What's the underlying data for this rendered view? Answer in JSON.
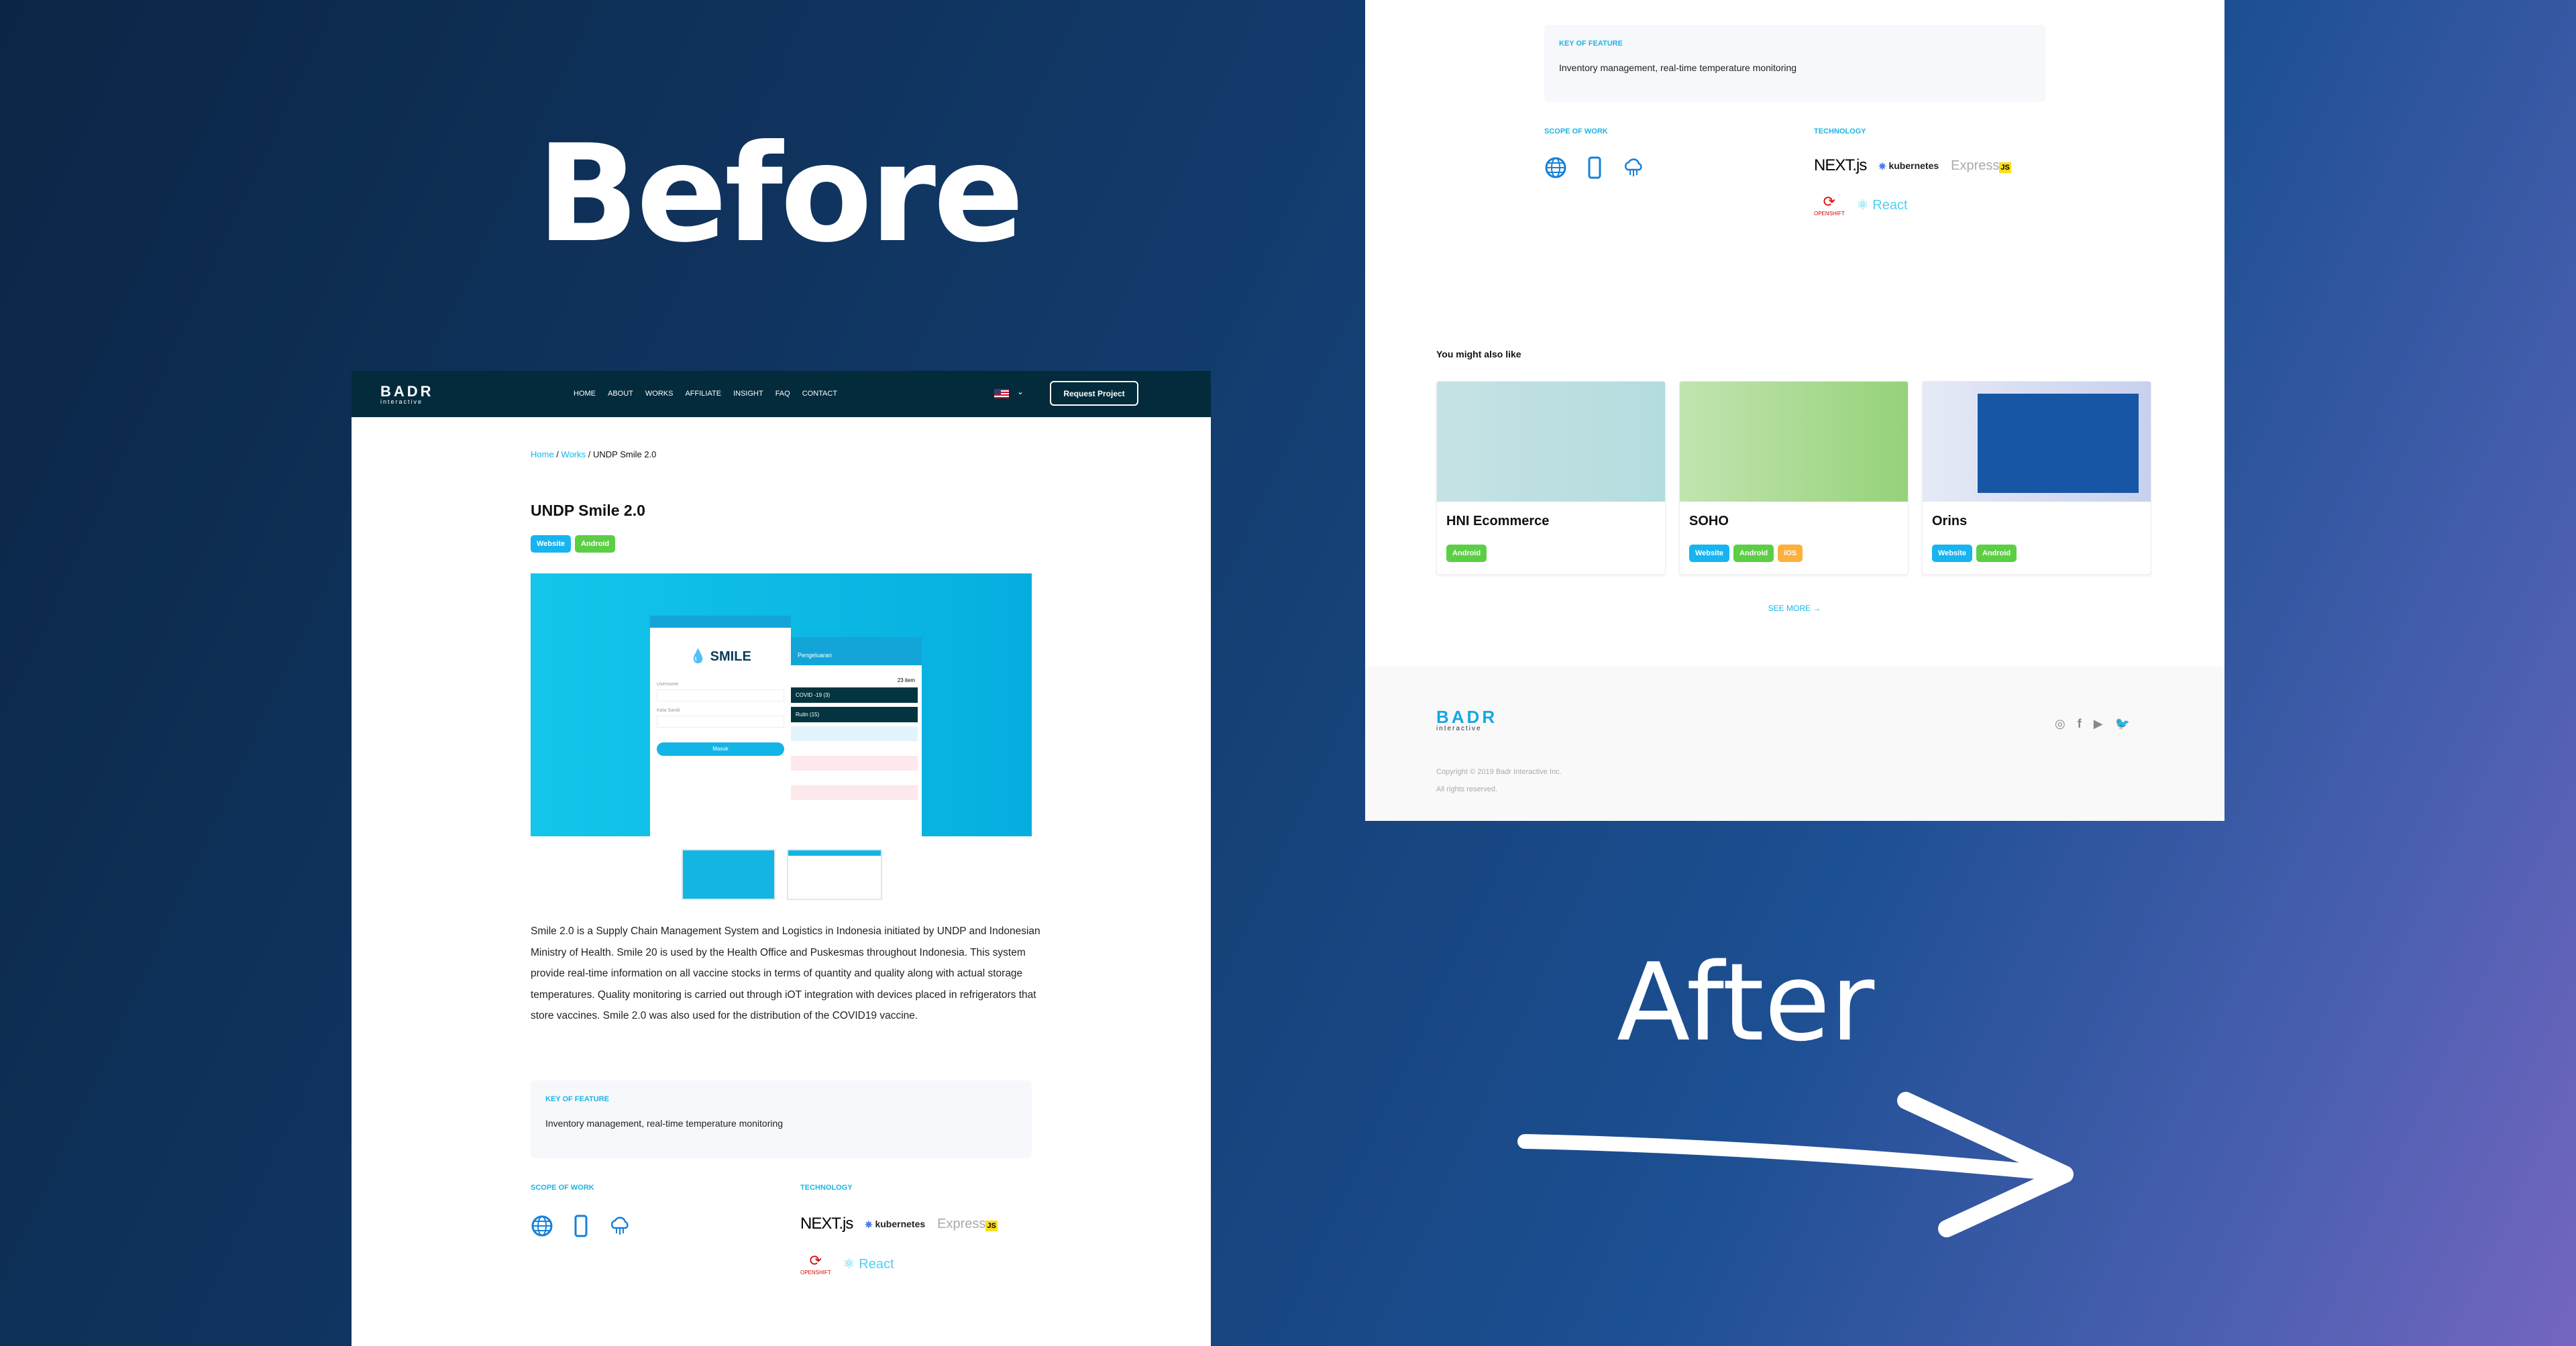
{
  "labels": {
    "before": "Before",
    "after": "After"
  },
  "colors": {
    "accent": "#15b6e8",
    "header": "#032b3b",
    "website_tag": "#17b4f0",
    "android_tag": "#5cce45",
    "ios_tag": "#fbb13c"
  },
  "site": {
    "logo": "BADR",
    "logo_sub": "interactive",
    "nav": [
      "HOME",
      "ABOUT",
      "WORKS",
      "AFFILIATE",
      "INSIGHT",
      "FAQ",
      "CONTACT"
    ],
    "language_icon": "us-flag-icon",
    "request_button": "Request Project",
    "breadcrumb": {
      "home": "Home",
      "works": "Works",
      "current": "UNDP Smile 2.0",
      "sep": " / "
    },
    "title": "UNDP Smile 2.0",
    "tags": [
      "Website",
      "Android"
    ],
    "hero": {
      "app_name": "SMILE",
      "login_button": "Masuk",
      "username_label": "Username",
      "password_label": "Kata Sandi",
      "screen2_title": "Pengeluaran",
      "group1": "COVID -19 (3)",
      "group2": "Rutin (15)",
      "count": "23 item"
    },
    "description": "Smile 2.0 is a Supply Chain Management System and Logistics in Indonesia initiated by UNDP and Indonesian Ministry of Health. Smile 20 is used by the Health Office and Puskesmas throughout Indonesia. This system provide real-time information on all vaccine stocks in terms of quantity and quality along with actual storage temperatures. Quality monitoring is carried out through iOT integration with devices placed in refrigerators that store vaccines. Smile 2.0 was also used for the distribution of the COVID19 vaccine.",
    "key_feature": {
      "label": "KEY OF FEATURE",
      "text": "Inventory management, real-time temperature monitoring"
    },
    "scope": {
      "label": "SCOPE OF WORK",
      "icons": [
        "globe-icon",
        "mobile-icon",
        "cloud-icon"
      ]
    },
    "technology": {
      "label": "TECHNOLOGY",
      "items": [
        "NEXT.js",
        "kubernetes",
        "Express",
        "JS",
        "OPENSHIFT",
        "React"
      ]
    },
    "related": {
      "heading": "You might also like",
      "cards": [
        {
          "title": "HNI Ecommerce",
          "tags": [
            "Android"
          ]
        },
        {
          "title": "SOHO",
          "tags": [
            "Website",
            "Android",
            "iOS"
          ]
        },
        {
          "title": "Orins",
          "tags": [
            "Website",
            "Android"
          ]
        }
      ],
      "see_more": "SEE MORE →"
    },
    "footer": {
      "copyright": "Copyright © 2019 Badr Interactive Inc.",
      "rights": "All rights reserved.",
      "social": [
        "instagram-icon",
        "facebook-icon",
        "youtube-icon",
        "twitter-icon"
      ]
    }
  }
}
